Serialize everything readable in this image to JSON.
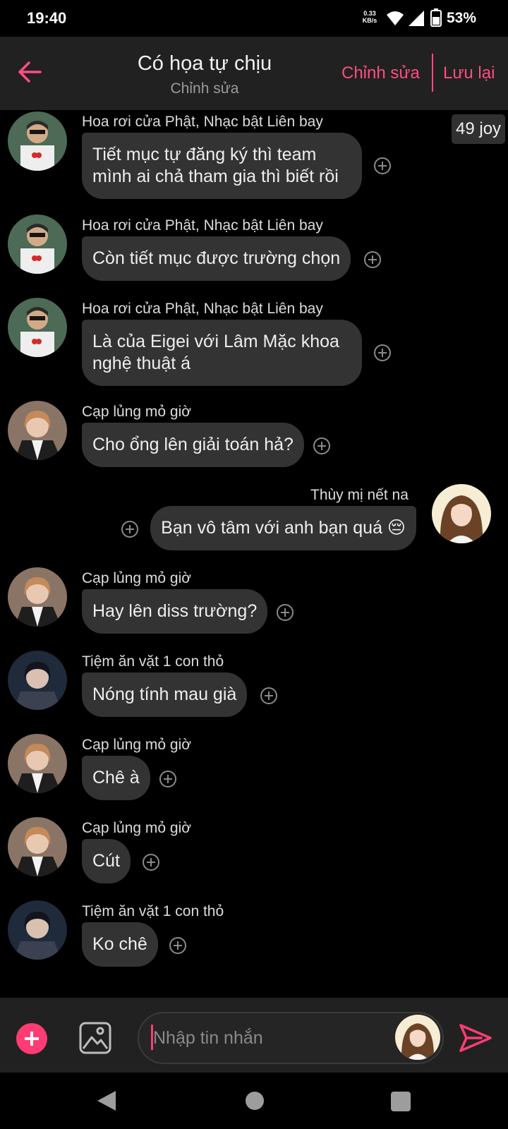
{
  "status_bar": {
    "time": "19:40",
    "net_speed_value": "0.33",
    "net_speed_unit": "KB/s",
    "battery": "53%",
    "icons": [
      "wifi-icon",
      "signal-icon",
      "battery-icon"
    ]
  },
  "header": {
    "title": "Có họa tự chịu",
    "subtitle": "Chỉnh sửa",
    "edit_label": "Chỉnh sửa",
    "save_label": "Lưu lại",
    "accent_color": "#ff4d7f",
    "back_icon": "back-arrow-icon"
  },
  "chat": {
    "joy_badge": "49 joy",
    "messages": [
      {
        "sender": "Hoa rơi cửa Phật, Nhạc bật Liên bay",
        "lines": [
          "Tiết mục tự đăng ký thì team",
          "mình ai chả tham gia thì biết rồi"
        ],
        "avatar": "avatar-white-shirt"
      },
      {
        "sender": "Hoa rơi cửa Phật, Nhạc bật Liên bay",
        "lines": [
          "Còn tiết mục được trường chọn"
        ],
        "avatar": "avatar-white-shirt"
      },
      {
        "sender": "Hoa rơi cửa Phật, Nhạc bật Liên bay",
        "lines": [
          "Là của Eigei với Lâm Mặc khoa",
          "nghệ thuật á"
        ],
        "avatar": "avatar-white-shirt"
      },
      {
        "sender": "Cạp lủng mỏ giờ",
        "lines": [
          "Cho ổng lên giải toán hả?"
        ],
        "avatar": "avatar-brown-hair"
      },
      {
        "sender": "Thùy mị nết na",
        "lines": [
          "Bạn vô tâm với anh bạn quá 😔"
        ],
        "avatar": "avatar-girl",
        "outgoing": true
      },
      {
        "sender": "Cạp lủng mỏ giờ",
        "lines": [
          "Hay lên diss trường?"
        ],
        "avatar": "avatar-brown-hair"
      },
      {
        "sender": "Tiệm ăn vặt 1 con thỏ",
        "lines": [
          "Nóng tính mau già"
        ],
        "avatar": "avatar-dark-suit"
      },
      {
        "sender": "Cạp lủng mỏ giờ",
        "lines": [
          "Chê à"
        ],
        "avatar": "avatar-brown-hair"
      },
      {
        "sender": "Cạp lủng mỏ giờ",
        "lines": [
          "Cút"
        ],
        "avatar": "avatar-brown-hair"
      },
      {
        "sender": "Tiệm ăn vặt 1 con thỏ",
        "lines": [
          "Ko chê"
        ],
        "avatar": "avatar-dark-suit"
      }
    ]
  },
  "composer": {
    "placeholder": "Nhập tin nhắn",
    "attach_icon": "plus-icon",
    "image_icon": "image-icon",
    "send_icon": "send-icon"
  },
  "nav_bar": {
    "icons": [
      "back-triangle-icon",
      "home-circle-icon",
      "recent-square-icon"
    ]
  }
}
